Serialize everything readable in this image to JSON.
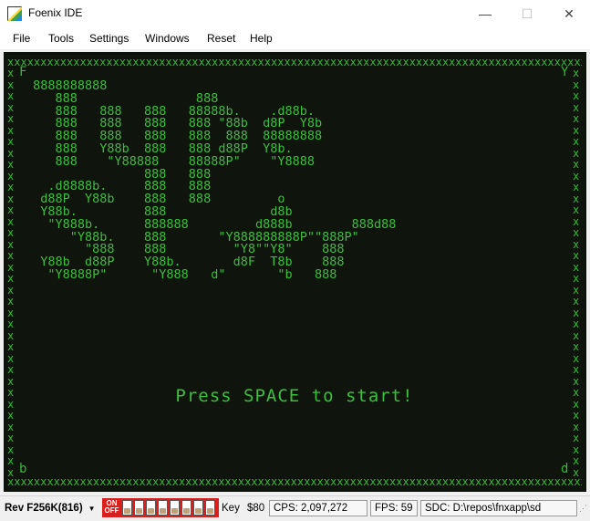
{
  "window": {
    "title": "Foenix IDE",
    "minimize_glyph": "—",
    "maximize_glyph": "☐",
    "close_glyph": "✕"
  },
  "menu": {
    "items": [
      "File",
      "Tools",
      "Settings",
      "Windows",
      "Reset",
      "Help"
    ]
  },
  "screen": {
    "corner_tl": "F",
    "corner_tr": "Y",
    "corner_bl": "b",
    "corner_br": "d",
    "border_row": "xxxxxxxxxxxxxxxxxxxxxxxxxxxxxxxxxxxxxxxxxxxxxxxxxxxxxxxxxxxxxxxxxxxxxxxxxxxxxxxxxxxxxxxxxxx",
    "ascii_art": " 8888888888\n    888                888\n    888   888   888   88888b.    .d88b.\n    888   888   888   888 \"88b  d8P  Y8b\n    888   888   888   888  888  88888888\n    888   Y88b  888   888 d88P  Y8b.\n    888    \"Y88888    88888P\"    \"Y8888\n                888   888\n   .d8888b.     888   888\n  d88P  Y88b    888   888         o\n  Y88b.         888              d8b\n   \"Y888b.      888888         d888b        888d88\n      \"Y88b.    888       \"Y888888888P\"\"888P\"\n        \"888    888         \"Y8\"\"Y8\"    888\n  Y88b  d88P    Y88b.       d8F  T8b    888\n   \"Y8888P\"      \"Y888   d\"       \"b   888",
    "prompt": "Press SPACE to start!"
  },
  "status": {
    "revision": "Rev F256K(816)",
    "dip_on": "ON",
    "dip_off": "OFF",
    "key_label": "Key",
    "key_value": "$80",
    "cps": "CPS: 2,097,272",
    "fps": "FPS: 59",
    "sdc": "SDC: D:\\repos\\fnxapp\\sd"
  }
}
